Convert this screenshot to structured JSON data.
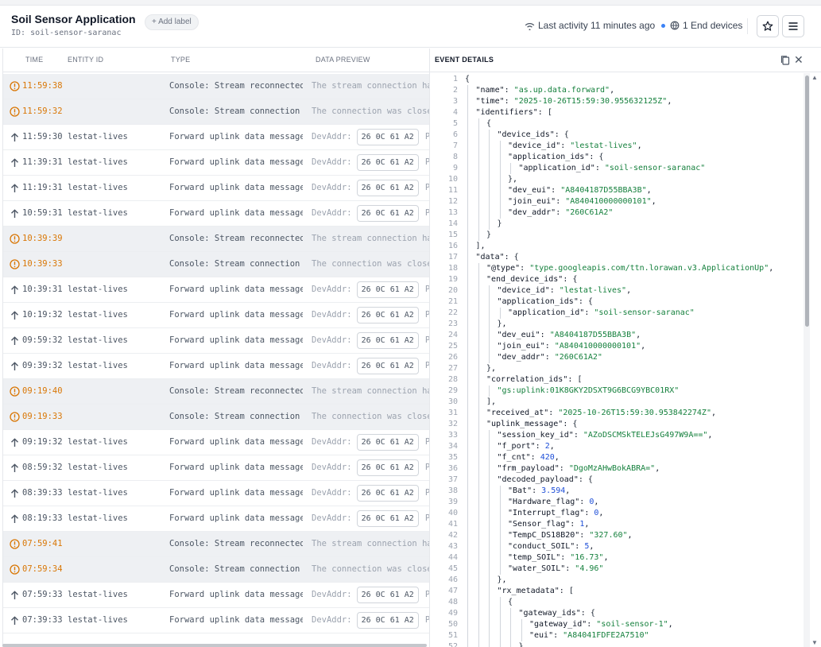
{
  "header": {
    "title": "Soil Sensor Application",
    "id_text": "ID: soil-sensor-saranac",
    "add_label": "+ Add label",
    "last_activity": "Last activity 11 minutes ago",
    "end_devices": "1 End devices"
  },
  "table": {
    "columns": [
      "TIME",
      "ENTITY ID",
      "TYPE",
      "DATA PREVIEW"
    ],
    "rows": [
      {
        "kind": "console",
        "time": "11:59:38",
        "entity": "",
        "type": "Console: Stream reconnected",
        "preview": "The stream connection has"
      },
      {
        "kind": "console",
        "time": "11:59:32",
        "entity": "",
        "type": "Console: Stream connection c…",
        "preview": "The connection was closed"
      },
      {
        "kind": "uplink",
        "time": "11:59:30",
        "entity": "lestat-lives",
        "type": "Forward uplink data message",
        "preview": "DevAddr:",
        "chip": "26 0C 61 A2",
        "pay": "Pay:"
      },
      {
        "kind": "uplink",
        "time": "11:39:31",
        "entity": "lestat-lives",
        "type": "Forward uplink data message",
        "preview": "DevAddr:",
        "chip": "26 0C 61 A2",
        "pay": "Pay:"
      },
      {
        "kind": "uplink",
        "time": "11:19:31",
        "entity": "lestat-lives",
        "type": "Forward uplink data message",
        "preview": "DevAddr:",
        "chip": "26 0C 61 A2",
        "pay": "Pay:"
      },
      {
        "kind": "uplink",
        "time": "10:59:31",
        "entity": "lestat-lives",
        "type": "Forward uplink data message",
        "preview": "DevAddr:",
        "chip": "26 0C 61 A2",
        "pay": "Pay:"
      },
      {
        "kind": "console",
        "time": "10:39:39",
        "entity": "",
        "type": "Console: Stream reconnected",
        "preview": "The stream connection has"
      },
      {
        "kind": "console",
        "time": "10:39:33",
        "entity": "",
        "type": "Console: Stream connection c…",
        "preview": "The connection was closed"
      },
      {
        "kind": "uplink",
        "time": "10:39:31",
        "entity": "lestat-lives",
        "type": "Forward uplink data message",
        "preview": "DevAddr:",
        "chip": "26 0C 61 A2",
        "pay": "Pay:"
      },
      {
        "kind": "uplink",
        "time": "10:19:32",
        "entity": "lestat-lives",
        "type": "Forward uplink data message",
        "preview": "DevAddr:",
        "chip": "26 0C 61 A2",
        "pay": "Pay:"
      },
      {
        "kind": "uplink",
        "time": "09:59:32",
        "entity": "lestat-lives",
        "type": "Forward uplink data message",
        "preview": "DevAddr:",
        "chip": "26 0C 61 A2",
        "pay": "Pay:"
      },
      {
        "kind": "uplink",
        "time": "09:39:32",
        "entity": "lestat-lives",
        "type": "Forward uplink data message",
        "preview": "DevAddr:",
        "chip": "26 0C 61 A2",
        "pay": "Pay:"
      },
      {
        "kind": "console",
        "time": "09:19:40",
        "entity": "",
        "type": "Console: Stream reconnected",
        "preview": "The stream connection has"
      },
      {
        "kind": "console",
        "time": "09:19:33",
        "entity": "",
        "type": "Console: Stream connection c…",
        "preview": "The connection was closed"
      },
      {
        "kind": "uplink",
        "time": "09:19:32",
        "entity": "lestat-lives",
        "type": "Forward uplink data message",
        "preview": "DevAddr:",
        "chip": "26 0C 61 A2",
        "pay": "Pay:"
      },
      {
        "kind": "uplink",
        "time": "08:59:32",
        "entity": "lestat-lives",
        "type": "Forward uplink data message",
        "preview": "DevAddr:",
        "chip": "26 0C 61 A2",
        "pay": "Pay:"
      },
      {
        "kind": "uplink",
        "time": "08:39:33",
        "entity": "lestat-lives",
        "type": "Forward uplink data message",
        "preview": "DevAddr:",
        "chip": "26 0C 61 A2",
        "pay": "Pay:"
      },
      {
        "kind": "uplink",
        "time": "08:19:33",
        "entity": "lestat-lives",
        "type": "Forward uplink data message",
        "preview": "DevAddr:",
        "chip": "26 0C 61 A2",
        "pay": "Pay:"
      },
      {
        "kind": "console",
        "time": "07:59:41",
        "entity": "",
        "type": "Console: Stream reconnected",
        "preview": "The stream connection has"
      },
      {
        "kind": "console",
        "time": "07:59:34",
        "entity": "",
        "type": "Console: Stream connection c…",
        "preview": "The connection was closed"
      },
      {
        "kind": "uplink",
        "time": "07:59:33",
        "entity": "lestat-lives",
        "type": "Forward uplink data message",
        "preview": "DevAddr:",
        "chip": "26 0C 61 A2",
        "pay": "Pay:"
      },
      {
        "kind": "uplink",
        "time": "07:39:33",
        "entity": "lestat-lives",
        "type": "Forward uplink data message",
        "preview": "DevAddr:",
        "chip": "26 0C 61 A2",
        "pay": "Pay:"
      }
    ]
  },
  "details": {
    "title": "EVENT DETAILS",
    "lines": [
      {
        "n": 1,
        "d": 0,
        "t": [
          [
            "br",
            "{"
          ]
        ]
      },
      {
        "n": 2,
        "d": 1,
        "t": [
          [
            "k",
            "\"name\": "
          ],
          [
            "s",
            "\"as.up.data.forward\""
          ],
          [
            "p",
            ","
          ]
        ]
      },
      {
        "n": 3,
        "d": 1,
        "t": [
          [
            "k",
            "\"time\": "
          ],
          [
            "s",
            "\"2025-10-26T15:59:30.955632125Z\""
          ],
          [
            "p",
            ","
          ]
        ]
      },
      {
        "n": 4,
        "d": 1,
        "t": [
          [
            "k",
            "\"identifiers\": "
          ],
          [
            "br",
            "["
          ]
        ]
      },
      {
        "n": 5,
        "d": 2,
        "t": [
          [
            "br",
            "{"
          ]
        ]
      },
      {
        "n": 6,
        "d": 3,
        "t": [
          [
            "k",
            "\"device_ids\": "
          ],
          [
            "br",
            "{"
          ]
        ]
      },
      {
        "n": 7,
        "d": 4,
        "t": [
          [
            "k",
            "\"device_id\": "
          ],
          [
            "s",
            "\"lestat-lives\""
          ],
          [
            "p",
            ","
          ]
        ]
      },
      {
        "n": 8,
        "d": 4,
        "t": [
          [
            "k",
            "\"application_ids\": "
          ],
          [
            "br",
            "{"
          ]
        ]
      },
      {
        "n": 9,
        "d": 5,
        "t": [
          [
            "k",
            "\"application_id\": "
          ],
          [
            "s",
            "\"soil-sensor-saranac\""
          ]
        ]
      },
      {
        "n": 10,
        "d": 4,
        "t": [
          [
            "br",
            "}"
          ],
          [
            "p",
            ","
          ]
        ]
      },
      {
        "n": 11,
        "d": 4,
        "t": [
          [
            "k",
            "\"dev_eui\": "
          ],
          [
            "s",
            "\"A8404187D55BBA3B\""
          ],
          [
            "p",
            ","
          ]
        ]
      },
      {
        "n": 12,
        "d": 4,
        "t": [
          [
            "k",
            "\"join_eui\": "
          ],
          [
            "s",
            "\"A840410000000101\""
          ],
          [
            "p",
            ","
          ]
        ]
      },
      {
        "n": 13,
        "d": 4,
        "t": [
          [
            "k",
            "\"dev_addr\": "
          ],
          [
            "s",
            "\"260C61A2\""
          ]
        ]
      },
      {
        "n": 14,
        "d": 3,
        "t": [
          [
            "br",
            "}"
          ]
        ]
      },
      {
        "n": 15,
        "d": 2,
        "t": [
          [
            "br",
            "}"
          ]
        ]
      },
      {
        "n": 16,
        "d": 1,
        "t": [
          [
            "br",
            "]"
          ],
          [
            "p",
            ","
          ]
        ]
      },
      {
        "n": 17,
        "d": 1,
        "t": [
          [
            "k",
            "\"data\": "
          ],
          [
            "br",
            "{"
          ]
        ]
      },
      {
        "n": 18,
        "d": 2,
        "t": [
          [
            "k",
            "\"@type\": "
          ],
          [
            "s",
            "\"type.googleapis.com/ttn.lorawan.v3.ApplicationUp\""
          ],
          [
            "p",
            ","
          ]
        ]
      },
      {
        "n": 19,
        "d": 2,
        "t": [
          [
            "k",
            "\"end_device_ids\": "
          ],
          [
            "br",
            "{"
          ]
        ]
      },
      {
        "n": 20,
        "d": 3,
        "t": [
          [
            "k",
            "\"device_id\": "
          ],
          [
            "s",
            "\"lestat-lives\""
          ],
          [
            "p",
            ","
          ]
        ]
      },
      {
        "n": 21,
        "d": 3,
        "t": [
          [
            "k",
            "\"application_ids\": "
          ],
          [
            "br",
            "{"
          ]
        ]
      },
      {
        "n": 22,
        "d": 4,
        "t": [
          [
            "k",
            "\"application_id\": "
          ],
          [
            "s",
            "\"soil-sensor-saranac\""
          ]
        ]
      },
      {
        "n": 23,
        "d": 3,
        "t": [
          [
            "br",
            "}"
          ],
          [
            "p",
            ","
          ]
        ]
      },
      {
        "n": 24,
        "d": 3,
        "t": [
          [
            "k",
            "\"dev_eui\": "
          ],
          [
            "s",
            "\"A8404187D55BBA3B\""
          ],
          [
            "p",
            ","
          ]
        ]
      },
      {
        "n": 25,
        "d": 3,
        "t": [
          [
            "k",
            "\"join_eui\": "
          ],
          [
            "s",
            "\"A840410000000101\""
          ],
          [
            "p",
            ","
          ]
        ]
      },
      {
        "n": 26,
        "d": 3,
        "t": [
          [
            "k",
            "\"dev_addr\": "
          ],
          [
            "s",
            "\"260C61A2\""
          ]
        ]
      },
      {
        "n": 27,
        "d": 2,
        "t": [
          [
            "br",
            "}"
          ],
          [
            "p",
            ","
          ]
        ]
      },
      {
        "n": 28,
        "d": 2,
        "t": [
          [
            "k",
            "\"correlation_ids\": "
          ],
          [
            "br",
            "["
          ]
        ]
      },
      {
        "n": 29,
        "d": 3,
        "t": [
          [
            "s",
            "\"gs:uplink:01K8GKY2DSXT9G6BCG9YBC01RX\""
          ]
        ]
      },
      {
        "n": 30,
        "d": 2,
        "t": [
          [
            "br",
            "]"
          ],
          [
            "p",
            ","
          ]
        ]
      },
      {
        "n": 31,
        "d": 2,
        "t": [
          [
            "k",
            "\"received_at\": "
          ],
          [
            "s",
            "\"2025-10-26T15:59:30.953842274Z\""
          ],
          [
            "p",
            ","
          ]
        ]
      },
      {
        "n": 32,
        "d": 2,
        "t": [
          [
            "k",
            "\"uplink_message\": "
          ],
          [
            "br",
            "{"
          ]
        ]
      },
      {
        "n": 33,
        "d": 3,
        "t": [
          [
            "k",
            "\"session_key_id\": "
          ],
          [
            "s",
            "\"AZoDSCMSkTELEJsG497W9A==\""
          ],
          [
            "p",
            ","
          ]
        ]
      },
      {
        "n": 34,
        "d": 3,
        "t": [
          [
            "k",
            "\"f_port\": "
          ],
          [
            "n",
            "2"
          ],
          [
            "p",
            ","
          ]
        ]
      },
      {
        "n": 35,
        "d": 3,
        "t": [
          [
            "k",
            "\"f_cnt\": "
          ],
          [
            "n",
            "420"
          ],
          [
            "p",
            ","
          ]
        ]
      },
      {
        "n": 36,
        "d": 3,
        "t": [
          [
            "k",
            "\"frm_payload\": "
          ],
          [
            "s",
            "\"DgoMzAHwBokABRA=\""
          ],
          [
            "p",
            ","
          ]
        ]
      },
      {
        "n": 37,
        "d": 3,
        "t": [
          [
            "k",
            "\"decoded_payload\": "
          ],
          [
            "br",
            "{"
          ]
        ]
      },
      {
        "n": 38,
        "d": 4,
        "t": [
          [
            "k",
            "\"Bat\": "
          ],
          [
            "n",
            "3.594"
          ],
          [
            "p",
            ","
          ]
        ]
      },
      {
        "n": 39,
        "d": 4,
        "t": [
          [
            "k",
            "\"Hardware_flag\": "
          ],
          [
            "n",
            "0"
          ],
          [
            "p",
            ","
          ]
        ]
      },
      {
        "n": 40,
        "d": 4,
        "t": [
          [
            "k",
            "\"Interrupt_flag\": "
          ],
          [
            "n",
            "0"
          ],
          [
            "p",
            ","
          ]
        ]
      },
      {
        "n": 41,
        "d": 4,
        "t": [
          [
            "k",
            "\"Sensor_flag\": "
          ],
          [
            "n",
            "1"
          ],
          [
            "p",
            ","
          ]
        ]
      },
      {
        "n": 42,
        "d": 4,
        "t": [
          [
            "k",
            "\"TempC_DS18B20\": "
          ],
          [
            "s",
            "\"327.60\""
          ],
          [
            "p",
            ","
          ]
        ]
      },
      {
        "n": 43,
        "d": 4,
        "t": [
          [
            "k",
            "\"conduct_SOIL\": "
          ],
          [
            "n",
            "5"
          ],
          [
            "p",
            ","
          ]
        ]
      },
      {
        "n": 44,
        "d": 4,
        "t": [
          [
            "k",
            "\"temp_SOIL\": "
          ],
          [
            "s",
            "\"16.73\""
          ],
          [
            "p",
            ","
          ]
        ]
      },
      {
        "n": 45,
        "d": 4,
        "t": [
          [
            "k",
            "\"water_SOIL\": "
          ],
          [
            "s",
            "\"4.96\""
          ]
        ]
      },
      {
        "n": 46,
        "d": 3,
        "t": [
          [
            "br",
            "}"
          ],
          [
            "p",
            ","
          ]
        ]
      },
      {
        "n": 47,
        "d": 3,
        "t": [
          [
            "k",
            "\"rx_metadata\": "
          ],
          [
            "br",
            "["
          ]
        ]
      },
      {
        "n": 48,
        "d": 4,
        "t": [
          [
            "br",
            "{"
          ]
        ]
      },
      {
        "n": 49,
        "d": 5,
        "t": [
          [
            "k",
            "\"gateway_ids\": "
          ],
          [
            "br",
            "{"
          ]
        ]
      },
      {
        "n": 50,
        "d": 6,
        "t": [
          [
            "k",
            "\"gateway_id\": "
          ],
          [
            "s",
            "\"soil-sensor-1\""
          ],
          [
            "p",
            ","
          ]
        ]
      },
      {
        "n": 51,
        "d": 6,
        "t": [
          [
            "k",
            "\"eui\": "
          ],
          [
            "s",
            "\"A84041FDFE2A7510\""
          ]
        ]
      },
      {
        "n": 52,
        "d": 5,
        "t": [
          [
            "br",
            "}"
          ],
          [
            "p",
            ","
          ]
        ]
      }
    ]
  },
  "colors": {
    "console_accent": "#d97706",
    "string": "#15803d",
    "number": "#1d4ed8",
    "live_dot": "#3b82f6"
  },
  "icons": {
    "activity": "signal-icon",
    "devices": "devices-icon",
    "favorite": "star-icon",
    "menu": "hamburger-icon",
    "console_row": "info-circle-icon",
    "uplink_row": "arrow-up-icon",
    "copy": "copy-icon",
    "close": "close-icon"
  }
}
